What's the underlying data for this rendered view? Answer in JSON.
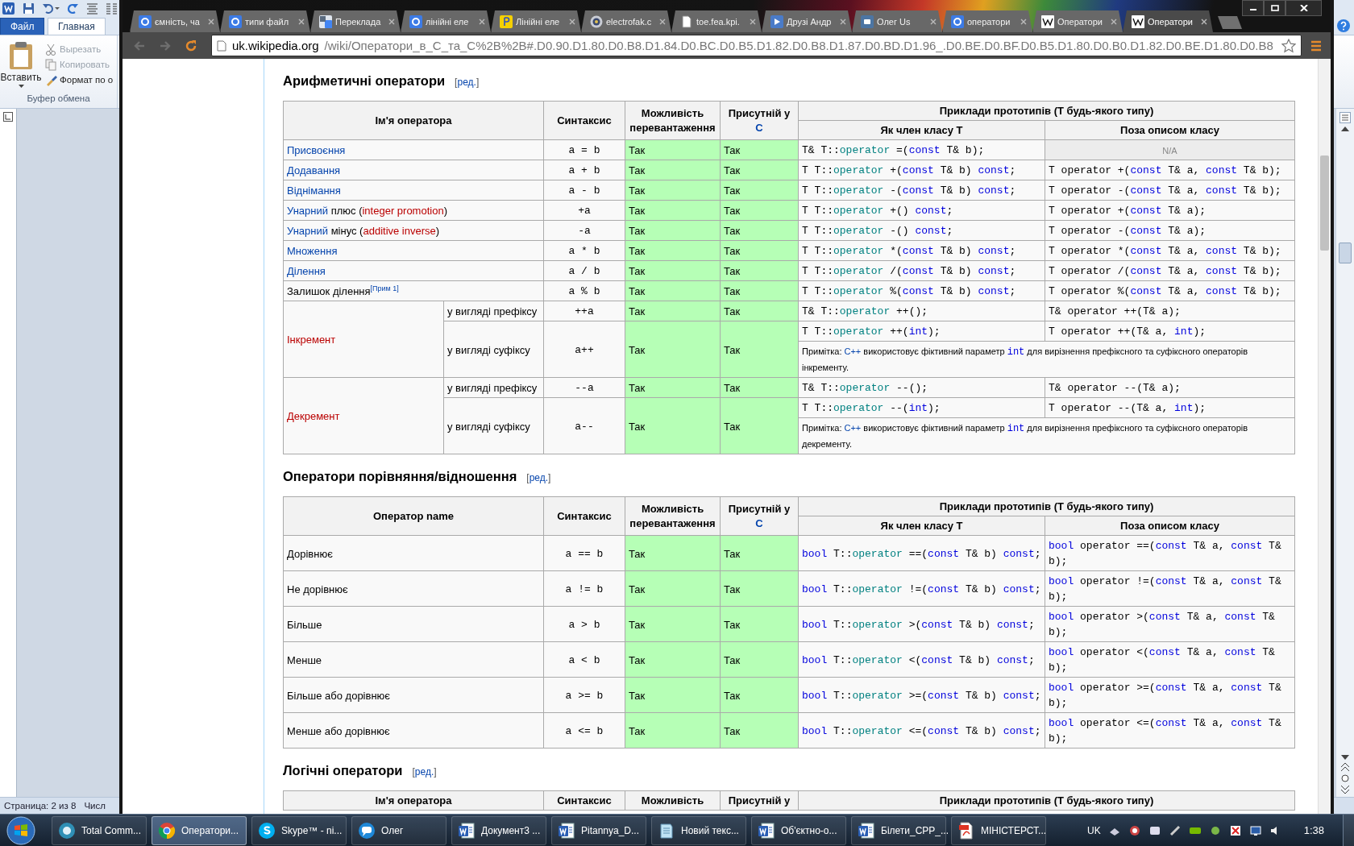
{
  "word": {
    "tabs": [
      {
        "label": "Файл",
        "kind": "file",
        "selected": false
      },
      {
        "label": "Главная",
        "kind": "tab",
        "selected": true
      }
    ],
    "clipboard": {
      "paste": "Вставить",
      "items": [
        {
          "label": "Вырезать",
          "kind": "scissors",
          "disabled": true
        },
        {
          "label": "Копировать",
          "kind": "copy",
          "disabled": true
        },
        {
          "label": "Формат по о",
          "kind": "brush",
          "disabled": false
        }
      ],
      "group": "Буфер обмена"
    },
    "status_bar": [
      "Страница: 2 из 8",
      "Числ"
    ]
  },
  "browser": {
    "tabs": [
      {
        "title": "ємність, ча",
        "kind": "google",
        "selected": false
      },
      {
        "title": "типи файл",
        "kind": "google",
        "selected": false
      },
      {
        "title": "Переклада",
        "kind": "translate",
        "selected": false
      },
      {
        "title": "лінійні еле",
        "kind": "google",
        "selected": false
      },
      {
        "title": "Лінійні еле",
        "kind": "yandex",
        "selected": false
      },
      {
        "title": "electrofak.c",
        "kind": "emblem",
        "selected": false
      },
      {
        "title": "toe.fea.kpi.",
        "kind": "page",
        "selected": false
      },
      {
        "title": "Друзі Андр",
        "kind": "video",
        "selected": false
      },
      {
        "title": "Олег Us",
        "kind": "vk",
        "selected": false
      },
      {
        "title": "оператори",
        "kind": "google",
        "selected": false
      },
      {
        "title": "Оператори",
        "kind": "wiki",
        "selected": false
      },
      {
        "title": "Оператори",
        "kind": "wiki",
        "selected": true
      }
    ],
    "nav": [
      {
        "kind": "back",
        "disabled": true
      },
      {
        "kind": "forward",
        "disabled": true
      },
      {
        "kind": "reload",
        "disabled": false
      }
    ],
    "address": {
      "host": "uk.wikipedia.org",
      "path": "/wiki/Оператори_в_C_та_C%2B%2B#.D0.90.D1.80.D0.B8.D1.84.D0.BC.D0.B5.D1.82.D0.B8.D1.87.D0.BD.D1.96_.D0.BE.D0.BF.D0.B5.D1.80.D0.B0.D1.82.D0.BE.D1.80.D0.B8"
    },
    "sections": [
      {
        "heading": "Арифметичні оператори",
        "edit": [
          {
            "kind": "plain",
            "text": "["
          },
          {
            "kind": "link",
            "text": "ред."
          },
          {
            "kind": "plain",
            "text": "]"
          }
        ],
        "header": {
          "name": "Ім'я оператора",
          "syntax": "Синтаксис",
          "overload": "Можливість перевантаження",
          "present": "Присутній у",
          "present_link": "C",
          "examples": "Приклади прототипів (T будь-якого типу)",
          "member": "Як член класу T",
          "nonmember": "Поза описом класу"
        },
        "rows": [
          {
            "name": [
              {
                "kind": "link",
                "text": "Присвоєння"
              }
            ],
            "syntax": "a = b",
            "overload": "Так",
            "in_c": "Так",
            "member": [
              {
                "kind": "plain",
                "text": "T& T::"
              },
              {
                "kind": "method",
                "text": "operator"
              },
              {
                "kind": "plain",
                "text": " =("
              },
              {
                "kind": "keyword",
                "text": "const"
              },
              {
                "kind": "plain",
                "text": " T& b);"
              }
            ],
            "nonmember": [
              {
                "kind": "na",
                "text": "N/A"
              }
            ]
          },
          {
            "name": [
              {
                "kind": "link",
                "text": "Додавання"
              }
            ],
            "syntax": "a + b",
            "overload": "Так",
            "in_c": "Так",
            "member": [
              {
                "kind": "plain",
                "text": "T T::"
              },
              {
                "kind": "method",
                "text": "operator"
              },
              {
                "kind": "plain",
                "text": " +("
              },
              {
                "kind": "keyword",
                "text": "const"
              },
              {
                "kind": "plain",
                "text": " T& b) "
              },
              {
                "kind": "keyword",
                "text": "const"
              },
              {
                "kind": "plain",
                "text": ";"
              }
            ],
            "nonmember": [
              {
                "kind": "plain",
                "text": "T operator +("
              },
              {
                "kind": "keyword",
                "text": "const"
              },
              {
                "kind": "plain",
                "text": " T& a, "
              },
              {
                "kind": "keyword",
                "text": "const"
              },
              {
                "kind": "plain",
                "text": " T& b);"
              }
            ]
          },
          {
            "name": [
              {
                "kind": "link",
                "text": "Віднімання"
              }
            ],
            "syntax": "a - b",
            "overload": "Так",
            "in_c": "Так",
            "member": [
              {
                "kind": "plain",
                "text": "T T::"
              },
              {
                "kind": "method",
                "text": "operator"
              },
              {
                "kind": "plain",
                "text": " -("
              },
              {
                "kind": "keyword",
                "text": "const"
              },
              {
                "kind": "plain",
                "text": " T& b) "
              },
              {
                "kind": "keyword",
                "text": "const"
              },
              {
                "kind": "plain",
                "text": ";"
              }
            ],
            "nonmember": [
              {
                "kind": "plain",
                "text": "T operator -("
              },
              {
                "kind": "keyword",
                "text": "const"
              },
              {
                "kind": "plain",
                "text": " T& a, "
              },
              {
                "kind": "keyword",
                "text": "const"
              },
              {
                "kind": "plain",
                "text": " T& b);"
              }
            ]
          },
          {
            "name": [
              {
                "kind": "link",
                "text": "Унарний"
              },
              {
                "kind": "plain",
                "text": " плюс ("
              },
              {
                "kind": "redlink",
                "text": "integer promotion"
              },
              {
                "kind": "plain",
                "text": ")"
              }
            ],
            "syntax": "+a",
            "overload": "Так",
            "in_c": "Так",
            "member": [
              {
                "kind": "plain",
                "text": "T T::"
              },
              {
                "kind": "method",
                "text": "operator"
              },
              {
                "kind": "plain",
                "text": " +() "
              },
              {
                "kind": "keyword",
                "text": "const"
              },
              {
                "kind": "plain",
                "text": ";"
              }
            ],
            "nonmember": [
              {
                "kind": "plain",
                "text": "T operator +("
              },
              {
                "kind": "keyword",
                "text": "const"
              },
              {
                "kind": "plain",
                "text": " T& a);"
              }
            ]
          },
          {
            "name": [
              {
                "kind": "link",
                "text": "Унарний"
              },
              {
                "kind": "plain",
                "text": " мінус ("
              },
              {
                "kind": "redlink",
                "text": "additive inverse"
              },
              {
                "kind": "plain",
                "text": ")"
              }
            ],
            "syntax": "-a",
            "overload": "Так",
            "in_c": "Так",
            "member": [
              {
                "kind": "plain",
                "text": "T T::"
              },
              {
                "kind": "method",
                "text": "operator"
              },
              {
                "kind": "plain",
                "text": " -() "
              },
              {
                "kind": "keyword",
                "text": "const"
              },
              {
                "kind": "plain",
                "text": ";"
              }
            ],
            "nonmember": [
              {
                "kind": "plain",
                "text": "T operator -("
              },
              {
                "kind": "keyword",
                "text": "const"
              },
              {
                "kind": "plain",
                "text": " T& a);"
              }
            ]
          },
          {
            "name": [
              {
                "kind": "link",
                "text": "Множення"
              }
            ],
            "syntax": "a * b",
            "overload": "Так",
            "in_c": "Так",
            "member": [
              {
                "kind": "plain",
                "text": "T T::"
              },
              {
                "kind": "method",
                "text": "operator"
              },
              {
                "kind": "plain",
                "text": " *("
              },
              {
                "kind": "keyword",
                "text": "const"
              },
              {
                "kind": "plain",
                "text": " T& b) "
              },
              {
                "kind": "keyword",
                "text": "const"
              },
              {
                "kind": "plain",
                "text": ";"
              }
            ],
            "nonmember": [
              {
                "kind": "plain",
                "text": "T operator *("
              },
              {
                "kind": "keyword",
                "text": "const"
              },
              {
                "kind": "plain",
                "text": " T& a, "
              },
              {
                "kind": "keyword",
                "text": "const"
              },
              {
                "kind": "plain",
                "text": " T& b);"
              }
            ]
          },
          {
            "name": [
              {
                "kind": "link",
                "text": "Ділення"
              }
            ],
            "syntax": "a / b",
            "overload": "Так",
            "in_c": "Так",
            "member": [
              {
                "kind": "plain",
                "text": "T T::"
              },
              {
                "kind": "method",
                "text": "operator"
              },
              {
                "kind": "plain",
                "text": " /("
              },
              {
                "kind": "keyword",
                "text": "const"
              },
              {
                "kind": "plain",
                "text": " T& b) "
              },
              {
                "kind": "keyword",
                "text": "const"
              },
              {
                "kind": "plain",
                "text": ";"
              }
            ],
            "nonmember": [
              {
                "kind": "plain",
                "text": "T operator /("
              },
              {
                "kind": "keyword",
                "text": "const"
              },
              {
                "kind": "plain",
                "text": " T& a, "
              },
              {
                "kind": "keyword",
                "text": "const"
              },
              {
                "kind": "plain",
                "text": " T& b);"
              }
            ]
          },
          {
            "name": [
              {
                "kind": "plain",
                "text": "Залишок ділення"
              },
              {
                "kind": "footnote",
                "text": "[Прим 1]"
              }
            ],
            "syntax": "a % b",
            "overload": "Так",
            "in_c": "Так",
            "member": [
              {
                "kind": "plain",
                "text": "T T::"
              },
              {
                "kind": "method",
                "text": "operator"
              },
              {
                "kind": "plain",
                "text": " %("
              },
              {
                "kind": "keyword",
                "text": "const"
              },
              {
                "kind": "plain",
                "text": " T& b) "
              },
              {
                "kind": "keyword",
                "text": "const"
              },
              {
                "kind": "plain",
                "text": ";"
              }
            ],
            "nonmember": [
              {
                "kind": "plain",
                "text": "T operator %("
              },
              {
                "kind": "keyword",
                "text": "const"
              },
              {
                "kind": "plain",
                "text": " T& a, "
              },
              {
                "kind": "keyword",
                "text": "const"
              },
              {
                "kind": "plain",
                "text": " T& b);"
              }
            ]
          },
          {
            "name": [
              {
                "kind": "redlink",
                "text": "Інкремент"
              }
            ],
            "variants": [
              {
                "form": "у вигляді префіксу",
                "syntax": "++a",
                "overload": "Так",
                "in_c": "Так",
                "member": [
                  {
                    "kind": "plain",
                    "text": "T& T::"
                  },
                  {
                    "kind": "method",
                    "text": "operator"
                  },
                  {
                    "kind": "plain",
                    "text": " ++();"
                  }
                ],
                "nonmember": [
                  {
                    "kind": "plain",
                    "text": "T& operator ++(T& a);"
                  }
                ]
              },
              {
                "form": "у вигляді суфіксу",
                "syntax": "a++",
                "overload": "Так",
                "in_c": "Так",
                "member": [
                  {
                    "kind": "plain",
                    "text": "T T::"
                  },
                  {
                    "kind": "method",
                    "text": "operator"
                  },
                  {
                    "kind": "plain",
                    "text": " ++("
                  },
                  {
                    "kind": "keyword",
                    "text": "int"
                  },
                  {
                    "kind": "plain",
                    "text": ");"
                  }
                ],
                "nonmember": [
                  {
                    "kind": "plain",
                    "text": "T operator ++(T& a, "
                  },
                  {
                    "kind": "keyword",
                    "text": "int"
                  },
                  {
                    "kind": "plain",
                    "text": ");"
                  }
                ],
                "note": [
                  {
                    "kind": "plain",
                    "text": "Примітка: "
                  },
                  {
                    "kind": "link",
                    "text": "C++"
                  },
                  {
                    "kind": "plain",
                    "text": " використовує фіктивний параметр "
                  },
                  {
                    "kind": "keyword",
                    "text": "int"
                  },
                  {
                    "kind": "plain",
                    "text": " для вирізнення префіксного та суфіксного операторів інкременту."
                  }
                ]
              }
            ]
          },
          {
            "name": [
              {
                "kind": "redlink",
                "text": "Декремент"
              }
            ],
            "variants": [
              {
                "form": "у вигляді префіксу",
                "syntax": "--a",
                "overload": "Так",
                "in_c": "Так",
                "member": [
                  {
                    "kind": "plain",
                    "text": "T& T::"
                  },
                  {
                    "kind": "method",
                    "text": "operator"
                  },
                  {
                    "kind": "plain",
                    "text": " --();"
                  }
                ],
                "nonmember": [
                  {
                    "kind": "plain",
                    "text": "T& operator --(T& a);"
                  }
                ]
              },
              {
                "form": "у вигляді суфіксу",
                "syntax": "a--",
                "overload": "Так",
                "in_c": "Так",
                "member": [
                  {
                    "kind": "plain",
                    "text": "T T::"
                  },
                  {
                    "kind": "method",
                    "text": "operator"
                  },
                  {
                    "kind": "plain",
                    "text": " --("
                  },
                  {
                    "kind": "keyword",
                    "text": "int"
                  },
                  {
                    "kind": "plain",
                    "text": ");"
                  }
                ],
                "nonmember": [
                  {
                    "kind": "plain",
                    "text": "T operator --(T& a, "
                  },
                  {
                    "kind": "keyword",
                    "text": "int"
                  },
                  {
                    "kind": "plain",
                    "text": ");"
                  }
                ],
                "note": [
                  {
                    "kind": "plain",
                    "text": "Примітка: "
                  },
                  {
                    "kind": "link",
                    "text": "C++"
                  },
                  {
                    "kind": "plain",
                    "text": " використовує фіктивний параметр "
                  },
                  {
                    "kind": "keyword",
                    "text": "int"
                  },
                  {
                    "kind": "plain",
                    "text": " для вирізнення префіксного та суфіксного операторів декременту."
                  }
                ]
              }
            ]
          }
        ]
      },
      {
        "heading": "Оператори порівняння/відношення",
        "edit": [
          {
            "kind": "plain",
            "text": "["
          },
          {
            "kind": "link",
            "text": "ред."
          },
          {
            "kind": "plain",
            "text": "]"
          }
        ],
        "header": {
          "name": "Оператор name",
          "syntax": "Синтаксис",
          "overload": "Можливість перевантаження",
          "present": "Присутній у",
          "present_link": "C",
          "examples": "Приклади прототипів (T будь-якого типу)",
          "member": "Як член класу T",
          "nonmember": "Поза описом класу"
        },
        "rows": [
          {
            "name": [
              {
                "kind": "plain",
                "text": "Дорівнює"
              }
            ],
            "syntax": "a == b",
            "overload": "Так",
            "in_c": "Так",
            "member": [
              {
                "kind": "keyword",
                "text": "bool"
              },
              {
                "kind": "plain",
                "text": " T::"
              },
              {
                "kind": "method",
                "text": "operator"
              },
              {
                "kind": "plain",
                "text": " ==("
              },
              {
                "kind": "keyword",
                "text": "const"
              },
              {
                "kind": "plain",
                "text": " T& b) "
              },
              {
                "kind": "keyword",
                "text": "const"
              },
              {
                "kind": "plain",
                "text": ";"
              }
            ],
            "nonmember": [
              {
                "kind": "keyword",
                "text": "bool"
              },
              {
                "kind": "plain",
                "text": " operator ==("
              },
              {
                "kind": "keyword",
                "text": "const"
              },
              {
                "kind": "plain",
                "text": " T& a, "
              },
              {
                "kind": "keyword",
                "text": "const"
              },
              {
                "kind": "plain",
                "text": " T& b);"
              }
            ]
          },
          {
            "name": [
              {
                "kind": "plain",
                "text": "Не дорівнює"
              }
            ],
            "syntax": "a != b",
            "overload": "Так",
            "in_c": "Так",
            "member": [
              {
                "kind": "keyword",
                "text": "bool"
              },
              {
                "kind": "plain",
                "text": " T::"
              },
              {
                "kind": "method",
                "text": "operator"
              },
              {
                "kind": "plain",
                "text": " !=("
              },
              {
                "kind": "keyword",
                "text": "const"
              },
              {
                "kind": "plain",
                "text": " T& b) "
              },
              {
                "kind": "keyword",
                "text": "const"
              },
              {
                "kind": "plain",
                "text": ";"
              }
            ],
            "nonmember": [
              {
                "kind": "keyword",
                "text": "bool"
              },
              {
                "kind": "plain",
                "text": " operator !=("
              },
              {
                "kind": "keyword",
                "text": "const"
              },
              {
                "kind": "plain",
                "text": " T& a, "
              },
              {
                "kind": "keyword",
                "text": "const"
              },
              {
                "kind": "plain",
                "text": " T& b);"
              }
            ]
          },
          {
            "name": [
              {
                "kind": "plain",
                "text": "Більше"
              }
            ],
            "syntax": "a > b",
            "overload": "Так",
            "in_c": "Так",
            "member": [
              {
                "kind": "keyword",
                "text": "bool"
              },
              {
                "kind": "plain",
                "text": " T::"
              },
              {
                "kind": "method",
                "text": "operator"
              },
              {
                "kind": "plain",
                "text": " >("
              },
              {
                "kind": "keyword",
                "text": "const"
              },
              {
                "kind": "plain",
                "text": " T& b) "
              },
              {
                "kind": "keyword",
                "text": "const"
              },
              {
                "kind": "plain",
                "text": ";"
              }
            ],
            "nonmember": [
              {
                "kind": "keyword",
                "text": "bool"
              },
              {
                "kind": "plain",
                "text": " operator >("
              },
              {
                "kind": "keyword",
                "text": "const"
              },
              {
                "kind": "plain",
                "text": " T& a, "
              },
              {
                "kind": "keyword",
                "text": "const"
              },
              {
                "kind": "plain",
                "text": " T& b);"
              }
            ]
          },
          {
            "name": [
              {
                "kind": "plain",
                "text": "Менше"
              }
            ],
            "syntax": "a < b",
            "overload": "Так",
            "in_c": "Так",
            "member": [
              {
                "kind": "keyword",
                "text": "bool"
              },
              {
                "kind": "plain",
                "text": " T::"
              },
              {
                "kind": "method",
                "text": "operator"
              },
              {
                "kind": "plain",
                "text": " <("
              },
              {
                "kind": "keyword",
                "text": "const"
              },
              {
                "kind": "plain",
                "text": " T& b) "
              },
              {
                "kind": "keyword",
                "text": "const"
              },
              {
                "kind": "plain",
                "text": ";"
              }
            ],
            "nonmember": [
              {
                "kind": "keyword",
                "text": "bool"
              },
              {
                "kind": "plain",
                "text": " operator <("
              },
              {
                "kind": "keyword",
                "text": "const"
              },
              {
                "kind": "plain",
                "text": " T& a, "
              },
              {
                "kind": "keyword",
                "text": "const"
              },
              {
                "kind": "plain",
                "text": " T& b);"
              }
            ]
          },
          {
            "name": [
              {
                "kind": "plain",
                "text": "Більше або дорівнює"
              }
            ],
            "syntax": "a >= b",
            "overload": "Так",
            "in_c": "Так",
            "member": [
              {
                "kind": "keyword",
                "text": "bool"
              },
              {
                "kind": "plain",
                "text": " T::"
              },
              {
                "kind": "method",
                "text": "operator"
              },
              {
                "kind": "plain",
                "text": " >=("
              },
              {
                "kind": "keyword",
                "text": "const"
              },
              {
                "kind": "plain",
                "text": " T& b) "
              },
              {
                "kind": "keyword",
                "text": "const"
              },
              {
                "kind": "plain",
                "text": ";"
              }
            ],
            "nonmember": [
              {
                "kind": "keyword",
                "text": "bool"
              },
              {
                "kind": "plain",
                "text": " operator >=("
              },
              {
                "kind": "keyword",
                "text": "const"
              },
              {
                "kind": "plain",
                "text": " T& a, "
              },
              {
                "kind": "keyword",
                "text": "const"
              },
              {
                "kind": "plain",
                "text": " T& b);"
              }
            ]
          },
          {
            "name": [
              {
                "kind": "plain",
                "text": "Менше або дорівнює"
              }
            ],
            "syntax": "a <= b",
            "overload": "Так",
            "in_c": "Так",
            "member": [
              {
                "kind": "keyword",
                "text": "bool"
              },
              {
                "kind": "plain",
                "text": " T::"
              },
              {
                "kind": "method",
                "text": "operator"
              },
              {
                "kind": "plain",
                "text": " <=("
              },
              {
                "kind": "keyword",
                "text": "const"
              },
              {
                "kind": "plain",
                "text": " T& b) "
              },
              {
                "kind": "keyword",
                "text": "const"
              },
              {
                "kind": "plain",
                "text": ";"
              }
            ],
            "nonmember": [
              {
                "kind": "keyword",
                "text": "bool"
              },
              {
                "kind": "plain",
                "text": " operator <=("
              },
              {
                "kind": "keyword",
                "text": "const"
              },
              {
                "kind": "plain",
                "text": " T& a, "
              },
              {
                "kind": "keyword",
                "text": "const"
              },
              {
                "kind": "plain",
                "text": " T& b);"
              }
            ]
          }
        ]
      },
      {
        "heading": "Логічні оператори",
        "edit": [
          {
            "kind": "plain",
            "text": "["
          },
          {
            "kind": "link",
            "text": "ред."
          },
          {
            "kind": "plain",
            "text": "]"
          }
        ],
        "header": {
          "name": "Ім'я оператора",
          "syntax": "Синтаксис",
          "overload": "Можливість",
          "present": "Присутній у",
          "examples": "Приклади прототипів (T будь-якого типу)"
        }
      }
    ]
  },
  "taskbar": {
    "items": [
      {
        "label": "Total Comm...",
        "kind": "commander",
        "selected": false
      },
      {
        "label": "Оператори...",
        "kind": "chrome",
        "selected": true
      },
      {
        "label": "Skype™ - ni...",
        "kind": "skype",
        "selected": false
      },
      {
        "label": "Олег",
        "kind": "chat",
        "selected": false
      },
      {
        "label": "Документ3 ...",
        "kind": "word",
        "selected": false
      },
      {
        "label": "Pitannya_D...",
        "kind": "word",
        "selected": false
      },
      {
        "label": "Новий текс...",
        "kind": "notepad",
        "selected": false
      },
      {
        "label": "Об'єктно-о...",
        "kind": "word",
        "selected": false
      },
      {
        "label": "Білети_CPP_...",
        "kind": "word",
        "selected": false
      },
      {
        "label": "МІНІСТЕРСТ...",
        "kind": "pdf",
        "selected": false
      }
    ],
    "language": "UK",
    "clock": "1:38"
  }
}
